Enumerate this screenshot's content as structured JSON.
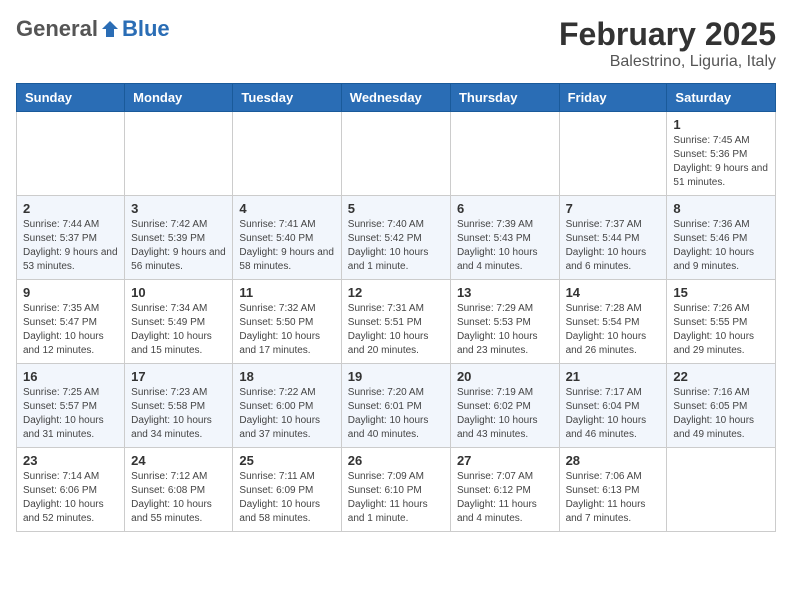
{
  "logo": {
    "general": "General",
    "blue": "Blue"
  },
  "title": "February 2025",
  "location": "Balestrino, Liguria, Italy",
  "weekdays": [
    "Sunday",
    "Monday",
    "Tuesday",
    "Wednesday",
    "Thursday",
    "Friday",
    "Saturday"
  ],
  "weeks": [
    [
      {
        "day": "",
        "info": ""
      },
      {
        "day": "",
        "info": ""
      },
      {
        "day": "",
        "info": ""
      },
      {
        "day": "",
        "info": ""
      },
      {
        "day": "",
        "info": ""
      },
      {
        "day": "",
        "info": ""
      },
      {
        "day": "1",
        "info": "Sunrise: 7:45 AM\nSunset: 5:36 PM\nDaylight: 9 hours and 51 minutes."
      }
    ],
    [
      {
        "day": "2",
        "info": "Sunrise: 7:44 AM\nSunset: 5:37 PM\nDaylight: 9 hours and 53 minutes."
      },
      {
        "day": "3",
        "info": "Sunrise: 7:42 AM\nSunset: 5:39 PM\nDaylight: 9 hours and 56 minutes."
      },
      {
        "day": "4",
        "info": "Sunrise: 7:41 AM\nSunset: 5:40 PM\nDaylight: 9 hours and 58 minutes."
      },
      {
        "day": "5",
        "info": "Sunrise: 7:40 AM\nSunset: 5:42 PM\nDaylight: 10 hours and 1 minute."
      },
      {
        "day": "6",
        "info": "Sunrise: 7:39 AM\nSunset: 5:43 PM\nDaylight: 10 hours and 4 minutes."
      },
      {
        "day": "7",
        "info": "Sunrise: 7:37 AM\nSunset: 5:44 PM\nDaylight: 10 hours and 6 minutes."
      },
      {
        "day": "8",
        "info": "Sunrise: 7:36 AM\nSunset: 5:46 PM\nDaylight: 10 hours and 9 minutes."
      }
    ],
    [
      {
        "day": "9",
        "info": "Sunrise: 7:35 AM\nSunset: 5:47 PM\nDaylight: 10 hours and 12 minutes."
      },
      {
        "day": "10",
        "info": "Sunrise: 7:34 AM\nSunset: 5:49 PM\nDaylight: 10 hours and 15 minutes."
      },
      {
        "day": "11",
        "info": "Sunrise: 7:32 AM\nSunset: 5:50 PM\nDaylight: 10 hours and 17 minutes."
      },
      {
        "day": "12",
        "info": "Sunrise: 7:31 AM\nSunset: 5:51 PM\nDaylight: 10 hours and 20 minutes."
      },
      {
        "day": "13",
        "info": "Sunrise: 7:29 AM\nSunset: 5:53 PM\nDaylight: 10 hours and 23 minutes."
      },
      {
        "day": "14",
        "info": "Sunrise: 7:28 AM\nSunset: 5:54 PM\nDaylight: 10 hours and 26 minutes."
      },
      {
        "day": "15",
        "info": "Sunrise: 7:26 AM\nSunset: 5:55 PM\nDaylight: 10 hours and 29 minutes."
      }
    ],
    [
      {
        "day": "16",
        "info": "Sunrise: 7:25 AM\nSunset: 5:57 PM\nDaylight: 10 hours and 31 minutes."
      },
      {
        "day": "17",
        "info": "Sunrise: 7:23 AM\nSunset: 5:58 PM\nDaylight: 10 hours and 34 minutes."
      },
      {
        "day": "18",
        "info": "Sunrise: 7:22 AM\nSunset: 6:00 PM\nDaylight: 10 hours and 37 minutes."
      },
      {
        "day": "19",
        "info": "Sunrise: 7:20 AM\nSunset: 6:01 PM\nDaylight: 10 hours and 40 minutes."
      },
      {
        "day": "20",
        "info": "Sunrise: 7:19 AM\nSunset: 6:02 PM\nDaylight: 10 hours and 43 minutes."
      },
      {
        "day": "21",
        "info": "Sunrise: 7:17 AM\nSunset: 6:04 PM\nDaylight: 10 hours and 46 minutes."
      },
      {
        "day": "22",
        "info": "Sunrise: 7:16 AM\nSunset: 6:05 PM\nDaylight: 10 hours and 49 minutes."
      }
    ],
    [
      {
        "day": "23",
        "info": "Sunrise: 7:14 AM\nSunset: 6:06 PM\nDaylight: 10 hours and 52 minutes."
      },
      {
        "day": "24",
        "info": "Sunrise: 7:12 AM\nSunset: 6:08 PM\nDaylight: 10 hours and 55 minutes."
      },
      {
        "day": "25",
        "info": "Sunrise: 7:11 AM\nSunset: 6:09 PM\nDaylight: 10 hours and 58 minutes."
      },
      {
        "day": "26",
        "info": "Sunrise: 7:09 AM\nSunset: 6:10 PM\nDaylight: 11 hours and 1 minute."
      },
      {
        "day": "27",
        "info": "Sunrise: 7:07 AM\nSunset: 6:12 PM\nDaylight: 11 hours and 4 minutes."
      },
      {
        "day": "28",
        "info": "Sunrise: 7:06 AM\nSunset: 6:13 PM\nDaylight: 11 hours and 7 minutes."
      },
      {
        "day": "",
        "info": ""
      }
    ]
  ]
}
